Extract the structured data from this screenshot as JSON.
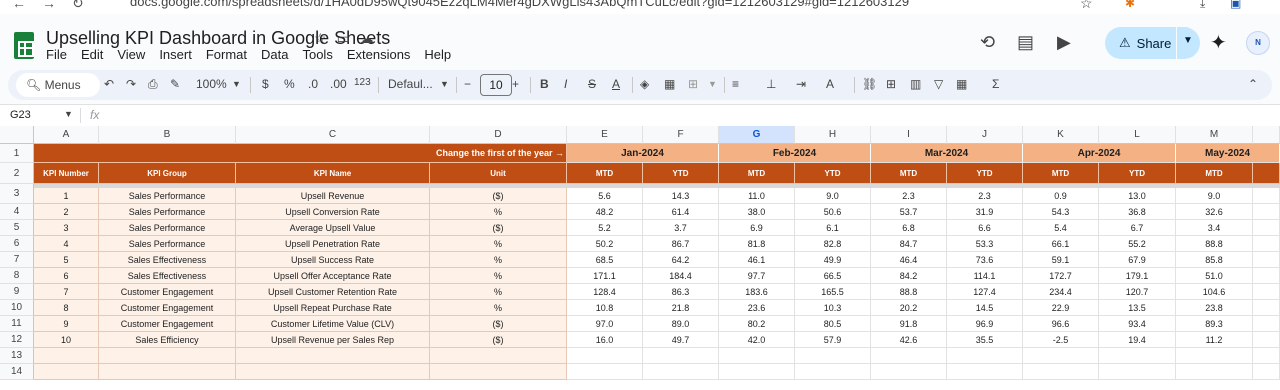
{
  "browser": {
    "url": "docs.google.com/spreadsheets/d/1HA0dD95wQt9045Ez2qLM4Mer4gDXWgLis43AbQmTCuLc/edit?gid=1212603129#gid=1212603129"
  },
  "doc": {
    "title": "Upselling KPI Dashboard in Google Sheets",
    "menu": [
      "File",
      "Edit",
      "View",
      "Insert",
      "Format",
      "Data",
      "Tools",
      "Extensions",
      "Help"
    ],
    "share_label": "Share",
    "avatar_text": "N"
  },
  "toolbar": {
    "search_label": "Menus",
    "zoom": "100%",
    "currency": "$",
    "percent": "%",
    "dec_decrease": ".0",
    "dec_increase": ".00",
    "number_format": "123",
    "font": "Defaul...",
    "font_size": "10",
    "bold": "B"
  },
  "formula_bar": {
    "cell_ref": "G23",
    "fx": "fx",
    "content": ""
  },
  "columns": [
    "A",
    "B",
    "C",
    "D",
    "E",
    "F",
    "G",
    "H",
    "I",
    "J",
    "K",
    "L",
    "M"
  ],
  "selected_column": "G",
  "row_numbers": [
    "1",
    "2",
    "3",
    "4",
    "5",
    "6",
    "7",
    "8",
    "9",
    "10",
    "11",
    "12",
    "13",
    "14"
  ],
  "sheet": {
    "change_label": "Change the first of the year →",
    "months": [
      "Jan-2024",
      "Feb-2024",
      "Mar-2024",
      "Apr-2024",
      "May-2024"
    ],
    "headers": [
      "KPI Number",
      "KPI Group",
      "KPI Name",
      "Unit"
    ],
    "sub_headers": [
      "MTD",
      "YTD",
      "MTD",
      "YTD",
      "MTD",
      "YTD",
      "MTD",
      "YTD",
      "MTD"
    ],
    "rows": [
      {
        "num": "1",
        "group": "Sales Performance",
        "name": "Upsell Revenue",
        "unit": "($)",
        "vals": [
          "5.6",
          "14.3",
          "11.0",
          "9.0",
          "2.3",
          "2.3",
          "0.9",
          "13.0",
          "9.0"
        ]
      },
      {
        "num": "2",
        "group": "Sales Performance",
        "name": "Upsell Conversion Rate",
        "unit": "%",
        "vals": [
          "48.2",
          "61.4",
          "38.0",
          "50.6",
          "53.7",
          "31.9",
          "54.3",
          "36.8",
          "32.6"
        ]
      },
      {
        "num": "3",
        "group": "Sales Performance",
        "name": "Average Upsell Value",
        "unit": "($)",
        "vals": [
          "5.2",
          "3.7",
          "6.9",
          "6.1",
          "6.8",
          "6.6",
          "5.4",
          "6.7",
          "3.4"
        ]
      },
      {
        "num": "4",
        "group": "Sales Performance",
        "name": "Upsell Penetration Rate",
        "unit": "%",
        "vals": [
          "50.2",
          "86.7",
          "81.8",
          "82.8",
          "84.7",
          "53.3",
          "66.1",
          "55.2",
          "88.8"
        ]
      },
      {
        "num": "5",
        "group": "Sales Effectiveness",
        "name": "Upsell Success Rate",
        "unit": "%",
        "vals": [
          "68.5",
          "64.2",
          "46.1",
          "49.9",
          "46.4",
          "73.6",
          "59.1",
          "67.9",
          "85.8"
        ]
      },
      {
        "num": "6",
        "group": "Sales Effectiveness",
        "name": "Upsell Offer Acceptance Rate",
        "unit": "%",
        "vals": [
          "171.1",
          "184.4",
          "97.7",
          "66.5",
          "84.2",
          "114.1",
          "172.7",
          "179.1",
          "51.0"
        ]
      },
      {
        "num": "7",
        "group": "Customer Engagement",
        "name": "Upsell Customer Retention Rate",
        "unit": "%",
        "vals": [
          "128.4",
          "86.3",
          "183.6",
          "165.5",
          "88.8",
          "127.4",
          "234.4",
          "120.7",
          "104.6"
        ]
      },
      {
        "num": "8",
        "group": "Customer Engagement",
        "name": "Upsell Repeat Purchase Rate",
        "unit": "%",
        "vals": [
          "10.8",
          "21.8",
          "23.6",
          "10.3",
          "20.2",
          "14.5",
          "22.9",
          "13.5",
          "23.8"
        ]
      },
      {
        "num": "9",
        "group": "Customer Engagement",
        "name": "Customer Lifetime Value (CLV)",
        "unit": "($)",
        "vals": [
          "97.0",
          "89.0",
          "80.2",
          "80.5",
          "91.8",
          "96.9",
          "96.6",
          "93.4",
          "89.3"
        ]
      },
      {
        "num": "10",
        "group": "Sales Efficiency",
        "name": "Upsell Revenue per Sales Rep",
        "unit": "($)",
        "vals": [
          "16.0",
          "49.7",
          "42.0",
          "57.9",
          "42.6",
          "35.5",
          "-2.5",
          "19.4",
          "11.2"
        ]
      }
    ]
  },
  "colors": {
    "header_dark": "#bf4e14",
    "header_light": "#f4b183",
    "peach_fill": "#fdf1e8",
    "share_bg": "#c2e7ff"
  }
}
